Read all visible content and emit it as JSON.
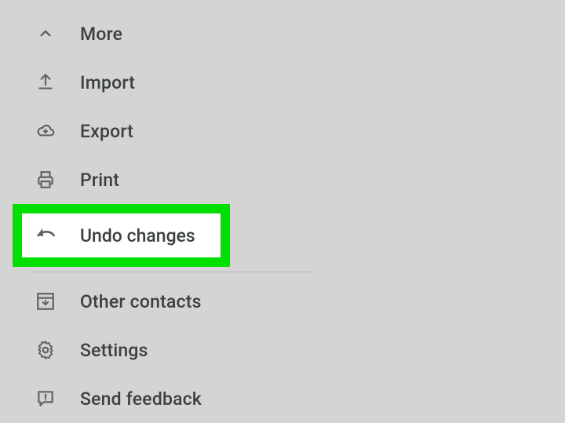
{
  "menu": {
    "more": "More",
    "import": "Import",
    "export": "Export",
    "print": "Print",
    "undo": "Undo changes",
    "other_contacts": "Other contacts",
    "settings": "Settings",
    "send_feedback": "Send feedback"
  }
}
